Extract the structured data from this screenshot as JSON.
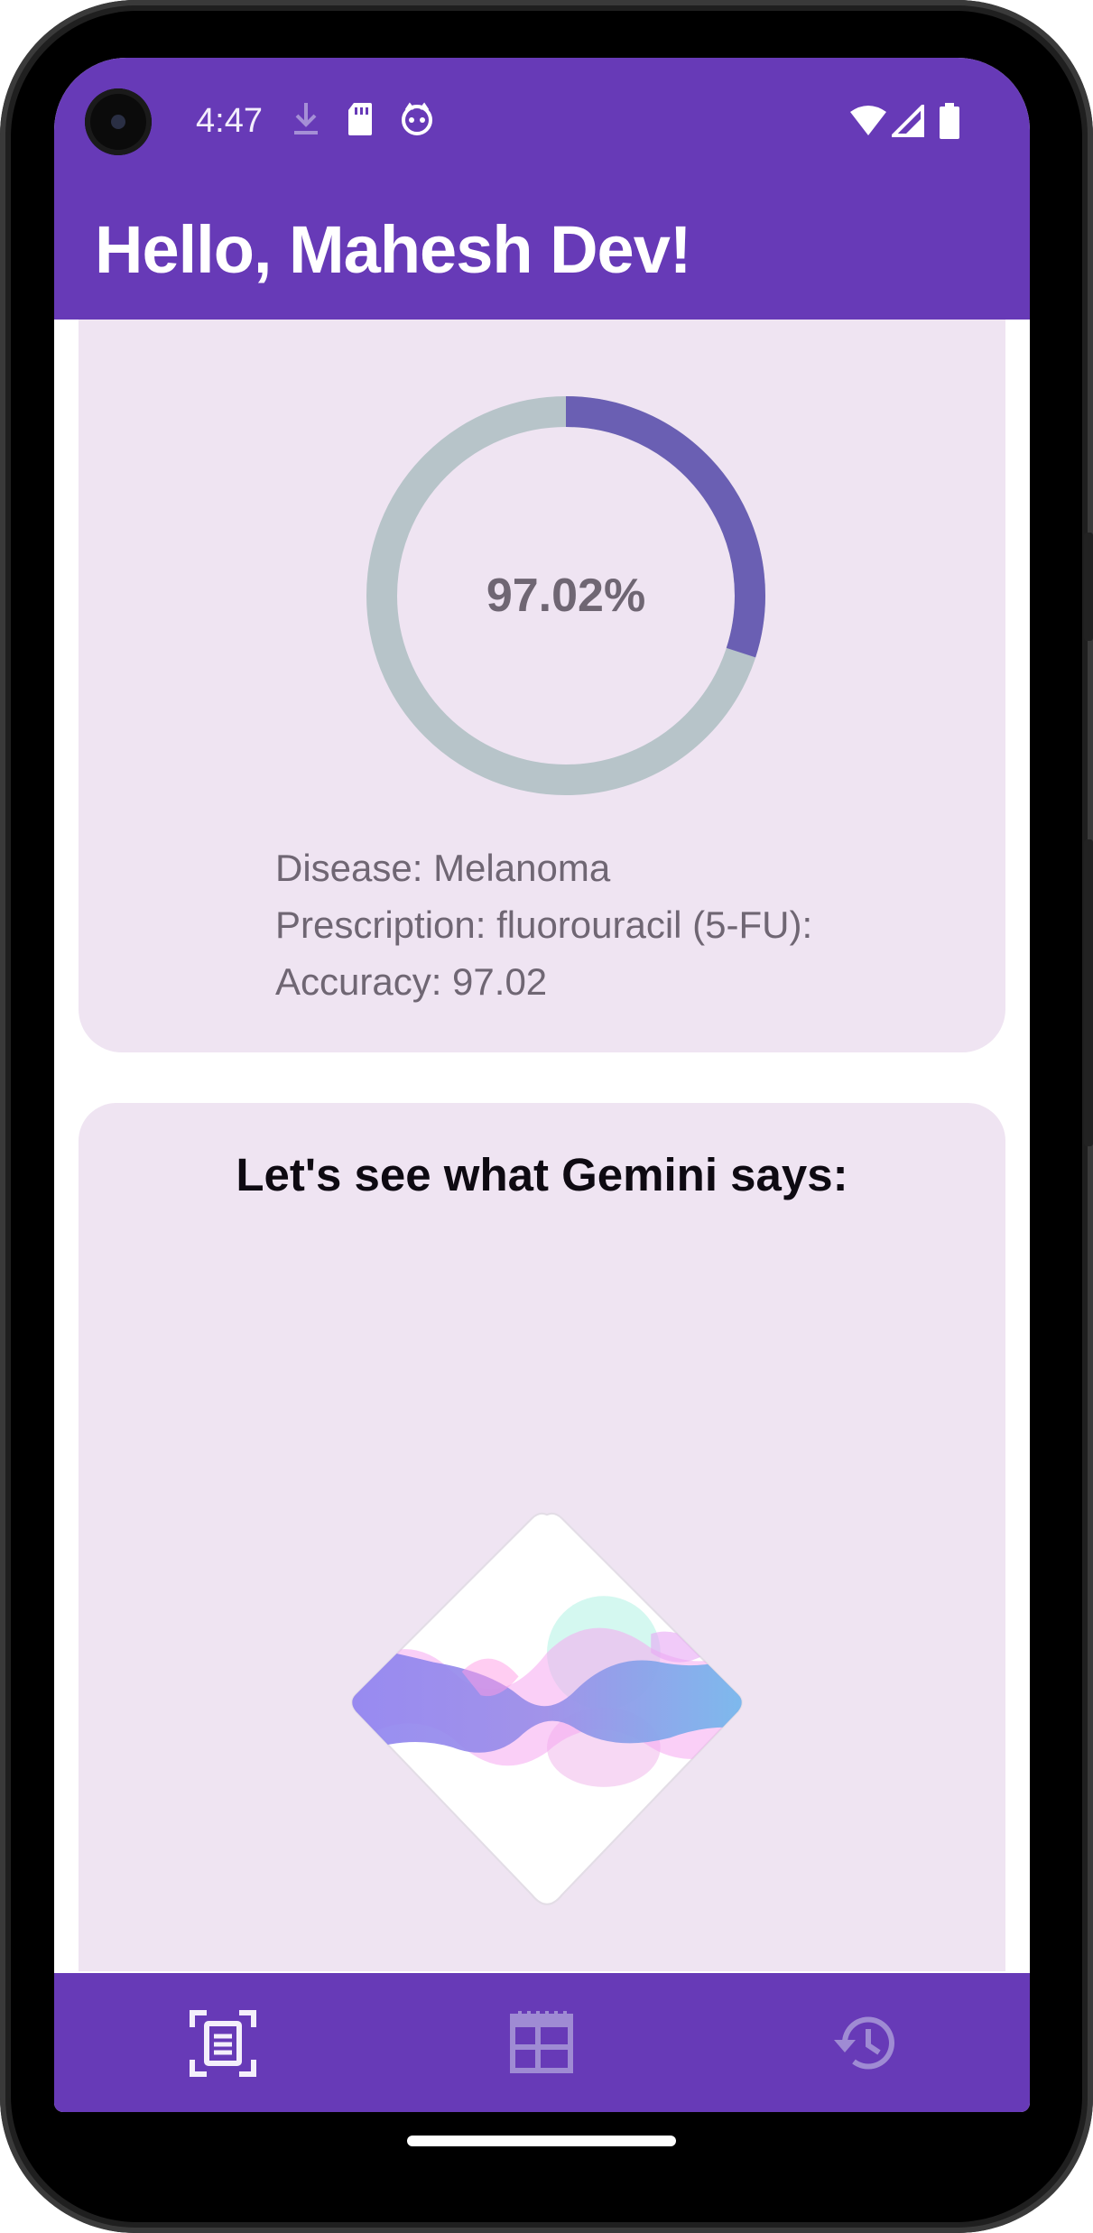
{
  "status_bar": {
    "time": "4:47",
    "left_icons": [
      "download-icon",
      "sd-card-icon",
      "app-notification-icon"
    ],
    "right_icons": [
      "wifi-icon",
      "cell-signal-icon",
      "battery-icon"
    ]
  },
  "app_bar": {
    "title": "Hello, Mahesh Dev!"
  },
  "result_card": {
    "progress_label": "97.02%",
    "progress_fraction": 0.3,
    "lines": [
      "Disease: Melanoma",
      "Prescription: fluorouracil (5-FU):",
      "Accuracy: 97.02"
    ]
  },
  "gemini_card": {
    "heading": "Let's see what Gemini says:",
    "logo_icon": "gemini-wave-logo"
  },
  "bottom_nav": {
    "items": [
      {
        "icon": "document-scan-icon",
        "active": true
      },
      {
        "icon": "table-dashboard-icon",
        "active": false
      },
      {
        "icon": "history-icon",
        "active": false
      }
    ]
  },
  "colors": {
    "primary": "#673ab7",
    "card": "#efe4f2",
    "ring_progress": "#6a5fb3",
    "ring_track": "#b7c4c9",
    "text_muted": "#6f6673"
  }
}
